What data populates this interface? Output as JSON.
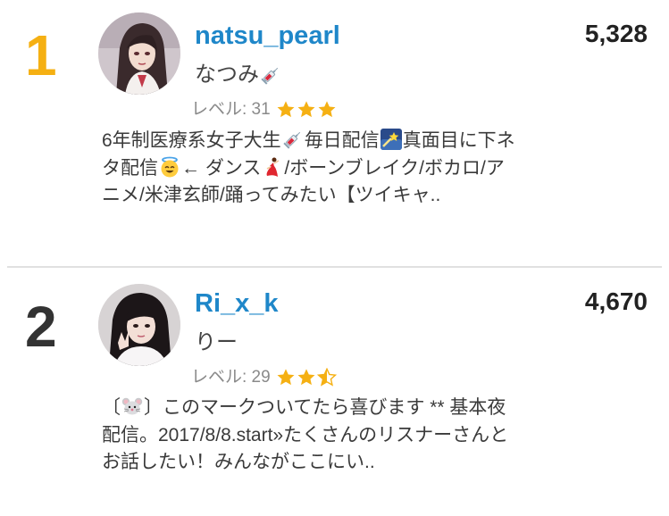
{
  "entries": [
    {
      "rank": "1",
      "username": "natsu_pearl",
      "display_name": "なつみ",
      "display_icon": "syringe-icon",
      "level_label": "レベル: 31",
      "stars": 3,
      "score": "5,328",
      "bio": {
        "p1": "6年制医療系女子大生",
        "p2": "毎日配信",
        "p3": "真面目に下ネタ配信",
        "p4": "← ダンス",
        "p5": "/ボーンブレイク/ボカロ/アニメ/米津玄師/踊ってみたい【ツイキャ.."
      },
      "bio_icons": [
        "syringe-icon",
        "shooting-star-icon",
        "halo-smile-icon",
        "dancer-icon"
      ]
    },
    {
      "rank": "2",
      "username": "Ri_x_k",
      "display_name": "りー",
      "level_label": "レベル: 29",
      "stars": 2.5,
      "score": "4,670",
      "bio": {
        "p1": "〔",
        "p2": "〕このマークついてたら喜びます ** 基本夜配信。2017/8/8.start»たくさんのリスナーさんとお話したい！みんながここにい.."
      },
      "bio_icons": [
        "mouse-face-icon"
      ]
    }
  ],
  "colors": {
    "rank1": "#f5b013",
    "rank2": "#333333",
    "username": "#1f87c9",
    "star": "#f5b013",
    "level_text": "#8a8a8a"
  }
}
